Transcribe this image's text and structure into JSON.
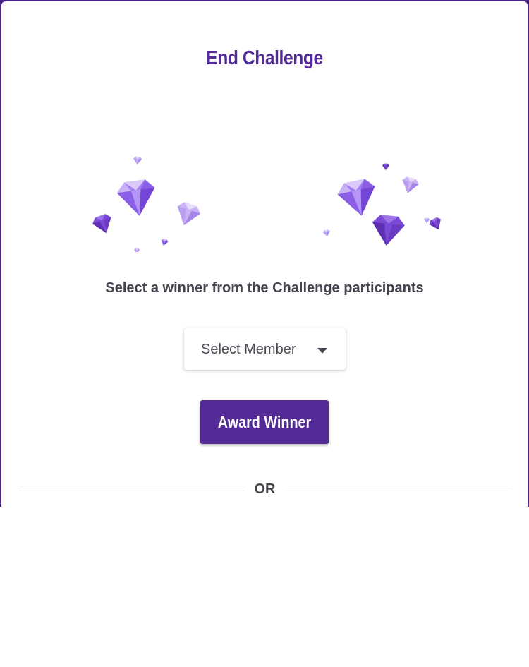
{
  "modal": {
    "title": "End Challenge",
    "prompt": "Select a winner from the Challenge participants",
    "select": {
      "label": "Select Member"
    },
    "award_button": "Award Winner",
    "divider_text": "OR"
  },
  "colors": {
    "brand": "#532a96",
    "backdrop": "#4a2585",
    "gem_light": "#c9b3f5",
    "gem_mid": "#a27ef0",
    "gem_dark": "#6b3ec4"
  },
  "icons": {
    "illustration": "diamond-gems-icon",
    "select_caret": "caret-down-icon"
  }
}
